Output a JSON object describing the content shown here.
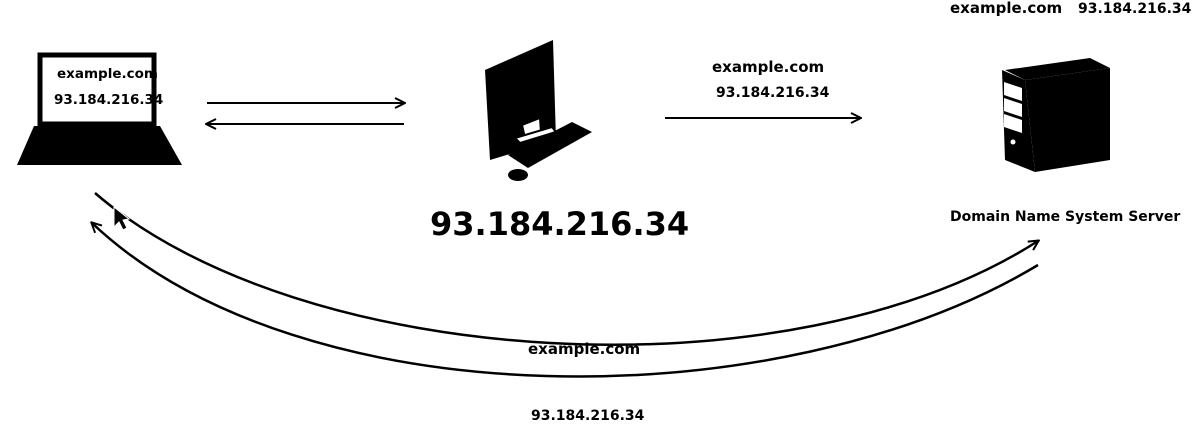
{
  "top_right": {
    "domain": "example.com",
    "ip": "93.184.216.34"
  },
  "laptop": {
    "domain": "example.com",
    "ip": "93.184.216.34"
  },
  "desktop": {
    "ip_caption": "93.184.216.34"
  },
  "desktop_to_dns": {
    "domain": "example.com",
    "ip": "93.184.216.34"
  },
  "dns_server": {
    "caption": "Domain Name System Server"
  },
  "lower_arc": {
    "domain": "example.com",
    "ip": "93.184.216.34"
  },
  "colors": {
    "ink": "#000000",
    "background": "#ffffff"
  }
}
